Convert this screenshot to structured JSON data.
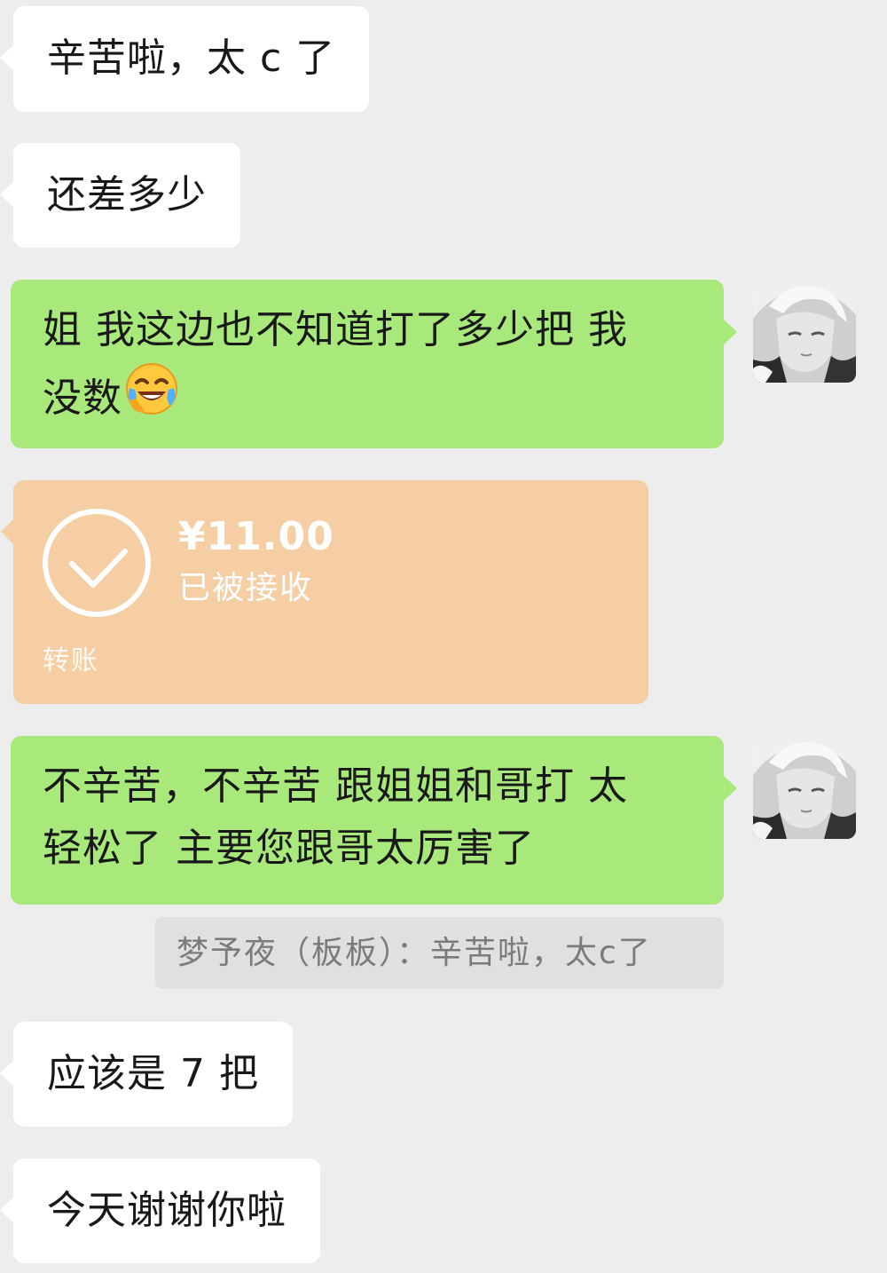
{
  "messages": [
    {
      "type": "received",
      "text": "辛苦啦，太 c 了"
    },
    {
      "type": "received",
      "text": "还差多少"
    },
    {
      "type": "sent",
      "lines": [
        "姐 我这边也不知道打了多少把 我",
        "没数"
      ],
      "emoji": "face-with-tears-of-joy"
    },
    {
      "type": "transfer",
      "amount": "¥11.00",
      "status": "已被接收",
      "label": "转账"
    },
    {
      "type": "sent",
      "lines": [
        "不辛苦，不辛苦 跟姐姐和哥打 太",
        "轻松了 主要您跟哥太厉害了"
      ]
    },
    {
      "type": "quote",
      "text": "梦予夜（板板）：辛苦啦，太c了"
    },
    {
      "type": "received",
      "text": "应该是 7 把"
    },
    {
      "type": "received",
      "text": "今天谢谢你啦"
    }
  ],
  "colors": {
    "background": "#ededed",
    "received_bubble": "#ffffff",
    "sent_bubble": "#a9e97b",
    "transfer_card": "#f5cfa3",
    "quote_background": "#e0e0e0"
  },
  "icons": {
    "transfer_status": "check-circle-icon",
    "avatar": "anime-avatar-grayscale"
  }
}
